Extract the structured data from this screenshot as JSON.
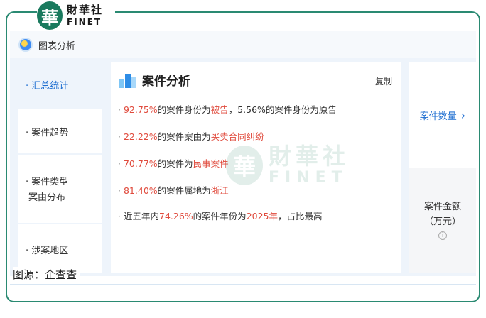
{
  "logo": {
    "glyph": "華",
    "text_cn": "財華社",
    "text_en": "FINET"
  },
  "header": {
    "title": "图表分析"
  },
  "sidebar": {
    "items": [
      {
        "lines": [
          "· 汇总统计"
        ]
      },
      {
        "lines": [
          "· 案件趋势"
        ]
      },
      {
        "lines": [
          "· 案件类型",
          "  案由分布"
        ]
      },
      {
        "lines": [
          "· 涉案地区"
        ]
      }
    ]
  },
  "content": {
    "title": "案件分析",
    "copy_label": "复制",
    "bullet": "·",
    "stats": [
      {
        "pre": "",
        "hl1": "92.75%",
        "mid": "的案件身份为",
        "hl2": "被告",
        "post": "，5.56%的案件身份为原告"
      },
      {
        "pre": "",
        "hl1": "22.22%",
        "mid": "的案件案由为",
        "hl2": "买卖合同纠纷",
        "post": ""
      },
      {
        "pre": "",
        "hl1": "70.77%",
        "mid": "的案件为",
        "hl2": "民事案件",
        "post": ""
      },
      {
        "pre": "",
        "hl1": "81.40%",
        "mid": "的案件属地为",
        "hl2": "浙江",
        "post": ""
      },
      {
        "pre": "近五年内",
        "hl1": "74.26%",
        "mid": "的案件年份为",
        "hl2": "2025年",
        "post": "，占比最高"
      }
    ]
  },
  "watermark": {
    "glyph": "華",
    "text_cn": "財華社",
    "text_en": "FINET"
  },
  "right": {
    "count_label": "案件数量",
    "count_chevron": "›",
    "amount_line1": "案件金额",
    "amount_line2": "（万元）",
    "info_icon": "i"
  },
  "source": {
    "text": "图源：企查查"
  },
  "colors": {
    "accent": "#1f6fd1",
    "highlight": "#e04a3c",
    "brand": "#1a7a5e"
  }
}
